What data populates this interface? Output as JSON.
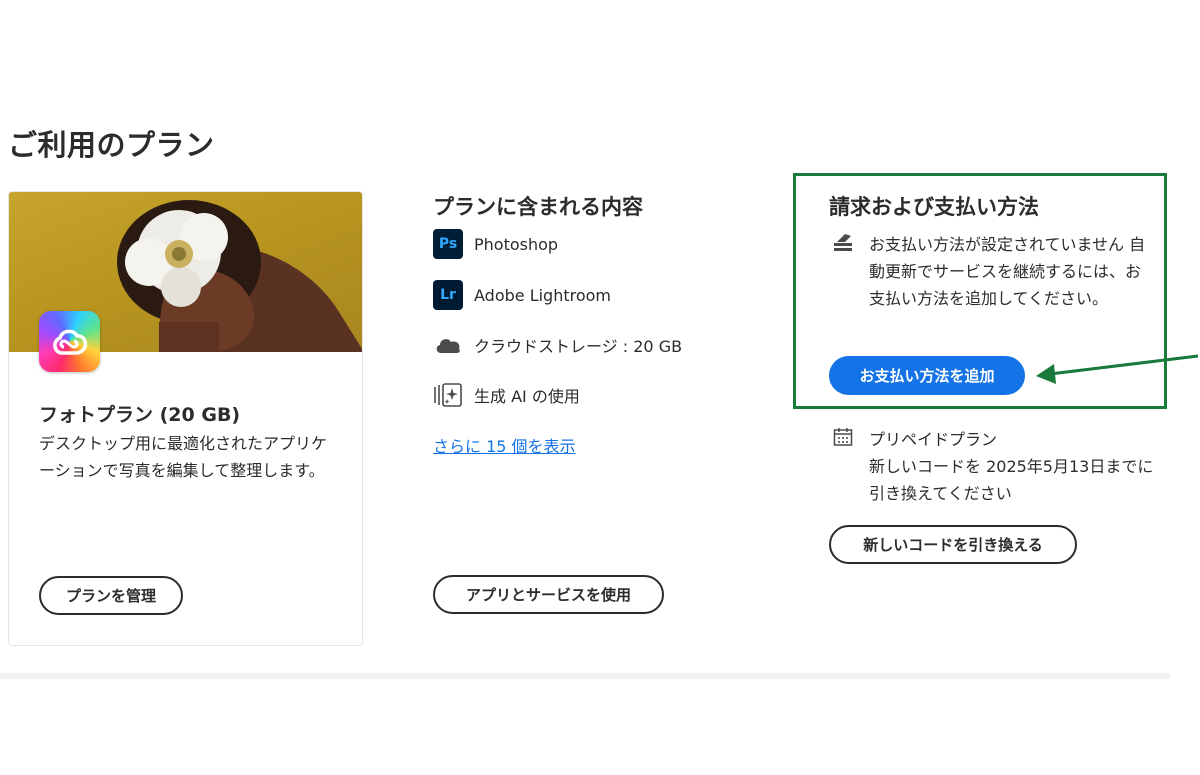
{
  "page": {
    "title": "ご利用のプラン"
  },
  "plan": {
    "name": "フォトプラン (20 GB)",
    "description": "デスクトップ用に最適化されたアプリケーションで写真を編集して整理します。",
    "manage_label": "プランを管理",
    "logo_icon": "creative-cloud-icon"
  },
  "included": {
    "title": "プランに含まれる内容",
    "items": [
      {
        "icon": "photoshop-icon",
        "icon_text": "Ps",
        "label": "Photoshop"
      },
      {
        "icon": "lightroom-icon",
        "icon_text": "Lr",
        "label": "Adobe Lightroom"
      },
      {
        "icon": "cloud-icon",
        "label": "クラウドストレージ : 20 GB"
      },
      {
        "icon": "generative-ai-icon",
        "label": "生成 AI の使用"
      }
    ],
    "more_link": "さらに 15 個を表示",
    "apps_button": "アプリとサービスを使用"
  },
  "billing": {
    "title": "請求および支払い方法",
    "message": "お支払い方法が設定されていません 自動更新でサービスを継続するには、お支払い方法を追加してください。",
    "add_payment_label": "お支払い方法を追加",
    "prepaid_title": "プリペイドプラン",
    "prepaid_message": "新しいコードを 2025年5月13日までに引き換えてください",
    "redeem_label": "新しいコードを引き換える"
  },
  "colors": {
    "accent": "#1473e6",
    "highlight_box": "#1a7a3c",
    "text": "#2c2c2c"
  }
}
